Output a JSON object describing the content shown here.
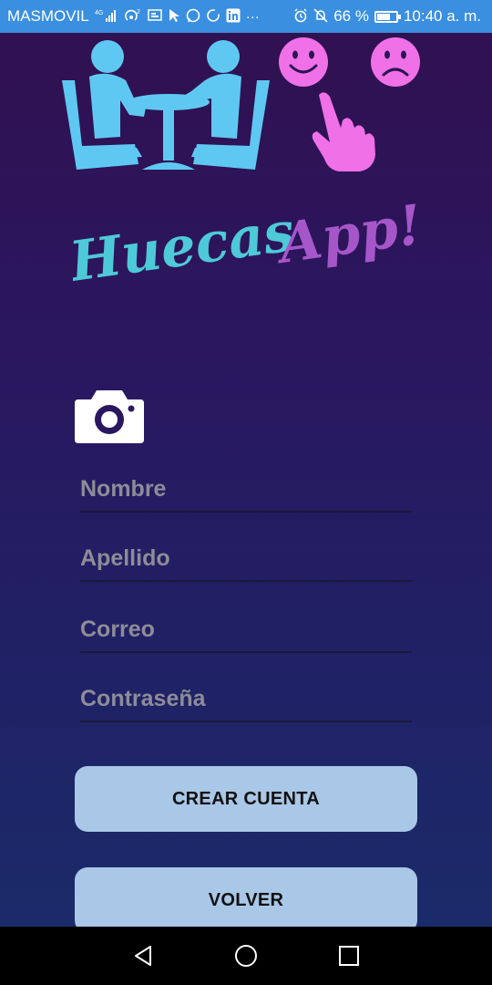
{
  "status_bar": {
    "carrier": "MASMOVIL",
    "network": "4G",
    "battery_percent": "66 %",
    "battery_level": 0.66,
    "time": "10:40 a. m.",
    "icons": [
      "signal-icon",
      "hotspot-icon",
      "cast-icon",
      "whatsapp-icon",
      "sync-icon",
      "linkedin-icon",
      "more-icon",
      "alarm-icon",
      "mute-icon",
      "battery-icon"
    ]
  },
  "brand": {
    "logo_part1": "Huecas",
    "logo_part2": "App!",
    "colors": {
      "cyan": "#4ec9d8",
      "purple": "#a556c9",
      "pink": "#f070e8",
      "light_blue": "#5fc8f2"
    }
  },
  "form": {
    "first_name": {
      "value": "",
      "placeholder": "Nombre"
    },
    "last_name": {
      "value": "",
      "placeholder": "Apellido"
    },
    "email": {
      "value": "",
      "placeholder": "Correo"
    },
    "password": {
      "value": "",
      "placeholder": "Contraseña"
    }
  },
  "buttons": {
    "create_account": "CREAR CUENTA",
    "back": "VOLVER"
  },
  "nav": [
    "back-icon",
    "home-icon",
    "recents-icon"
  ]
}
